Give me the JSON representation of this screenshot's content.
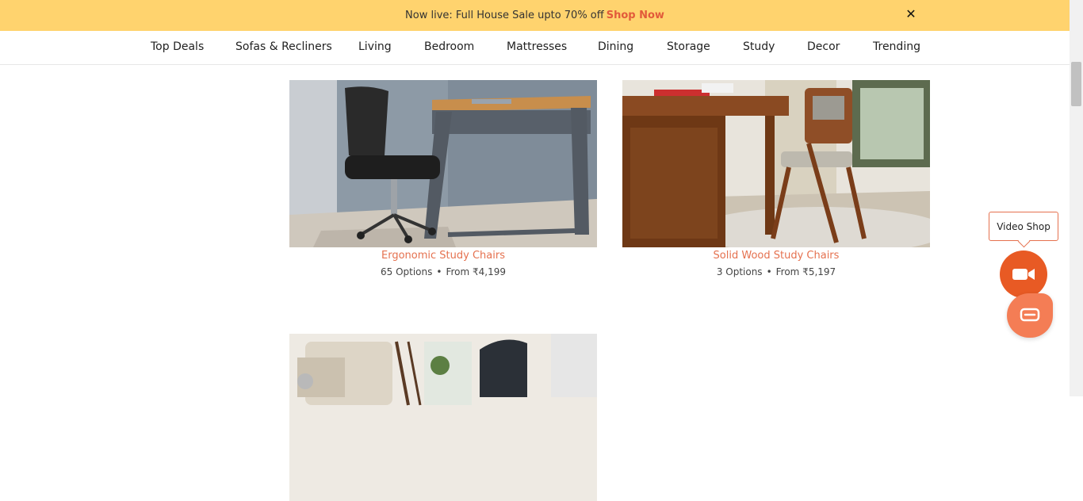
{
  "promo": {
    "text": "Now live: Full House Sale upto 70% off",
    "link": "Shop Now",
    "close": "✕"
  },
  "nav": {
    "items": [
      "Top Deals",
      "Sofas & Recliners",
      "Living",
      "Bedroom",
      "Mattresses",
      "Dining",
      "Storage",
      "Study",
      "Decor",
      "Trending"
    ]
  },
  "products": [
    {
      "title": "Ergonomic Study Chairs",
      "options": "65 Options",
      "price": "From ₹4,199"
    },
    {
      "title": "Solid Wood Study Chairs",
      "options": "3 Options",
      "price": "From ₹5,197"
    }
  ],
  "widgets": {
    "video_shop": "Video Shop",
    "video_icon": "video-camera-icon",
    "chat_icon": "chat-icon"
  },
  "colors": {
    "promo_bg": "#ffd36e",
    "accent": "#e5714f",
    "video_button": "#e85a24"
  }
}
